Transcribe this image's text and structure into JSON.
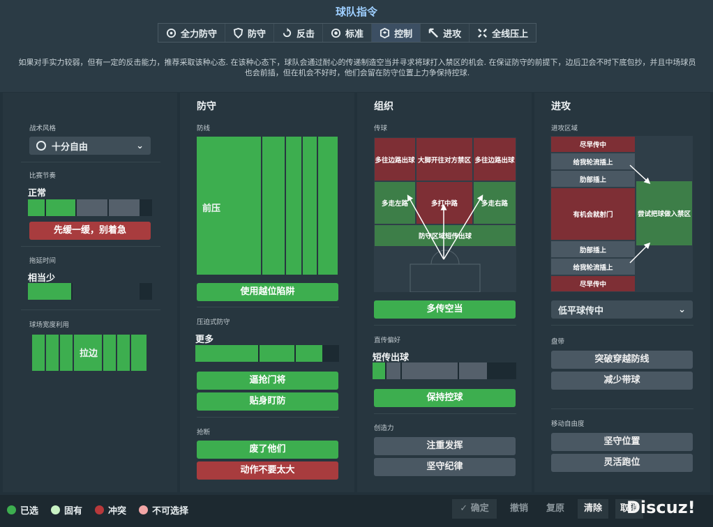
{
  "header": {
    "title": "球队指令",
    "tabs": [
      {
        "label": "全力防守",
        "icon": "shield-star-icon"
      },
      {
        "label": "防守",
        "icon": "shield-icon"
      },
      {
        "label": "反击",
        "icon": "counter-icon"
      },
      {
        "label": "标准",
        "icon": "balance-icon"
      },
      {
        "label": "控制",
        "icon": "control-icon",
        "active": true
      },
      {
        "label": "进攻",
        "icon": "attack-arrow-icon"
      },
      {
        "label": "全线压上",
        "icon": "all-out-icon"
      }
    ],
    "description": "如果对手实力较弱，但有一定的反击能力，推荐采取该种心态. 在该种心态下，球队会通过耐心的传递制造空当并寻求将球打入禁区的机会. 在保证防守的前提下，边后卫会不时下底包抄，并且中场球员也会前插，但在机会不好时，他们会留在防守位置上力争保持控球."
  },
  "left": {
    "style_label": "战术风格",
    "style_value": "十分自由",
    "tempo_label": "比赛节奏",
    "tempo_value": "正常",
    "tempo_button": "先缓一缓，别着急",
    "time_label": "拖延时间",
    "time_value": "相当少",
    "width_label": "球场宽度利用",
    "width_value": "拉边"
  },
  "defense": {
    "heading": "防守",
    "line_label": "防线",
    "line_value": "前压",
    "line_button": "使用越位陷阱",
    "press_label": "压迫式防守",
    "press_value": "更多",
    "press_btn1": "逼抢门将",
    "press_btn2": "贴身盯防",
    "tackle_label": "抢断",
    "tackle_btn1": "废了他们",
    "tackle_btn2": "动作不要太大"
  },
  "build": {
    "heading": "组织",
    "pass_label": "传球",
    "zones": {
      "tl": "多往边路出球",
      "tm": "大脚开往对方禁区",
      "tr": "多往边路出球",
      "ml": "多走左路",
      "mm": "多打中路",
      "mr": "多走右路",
      "bottom": "防守区域短传出球"
    },
    "pass_button": "多传空当",
    "direct_label": "直传偏好",
    "direct_value": "短传出球",
    "direct_button": "保持控球",
    "creative_label": "创造力",
    "creative_btn1": "注重发挥",
    "creative_btn2": "坚守纪律"
  },
  "attack": {
    "heading": "进攻",
    "zone_label": "进攻区域",
    "zones": {
      "z1": "尽早传中",
      "z2": "给我轮流插上",
      "z3": "肋部插上",
      "z4": "有机会就射门",
      "z5": "尝试把球做入禁区",
      "z6": "肋部插上",
      "z7": "给我轮流插上",
      "z8": "尽早传中"
    },
    "cross_value": "低平球传中",
    "dribble_label": "盘带",
    "dribble_btn1": "突破穿越防线",
    "dribble_btn2": "减少带球",
    "freedom_label": "移动自由度",
    "freedom_btn1": "坚守位置",
    "freedom_btn2": "灵活跑位"
  },
  "footer": {
    "legend": [
      {
        "label": "已选",
        "color": "#3dae4f"
      },
      {
        "label": "固有",
        "color": "#c9f2c4"
      },
      {
        "label": "冲突",
        "color": "#b8393b"
      },
      {
        "label": "不可选择",
        "color": "#f2a6a6"
      }
    ],
    "confirm": "确定",
    "undo": "撤销",
    "redo": "复原",
    "clear": "清除",
    "cancel": "取消",
    "watermark": "Discuz!"
  },
  "colors": {
    "green": "#3dae4f",
    "red": "#a83c3e",
    "grey": "#4a5863",
    "panel": "#27363f"
  }
}
